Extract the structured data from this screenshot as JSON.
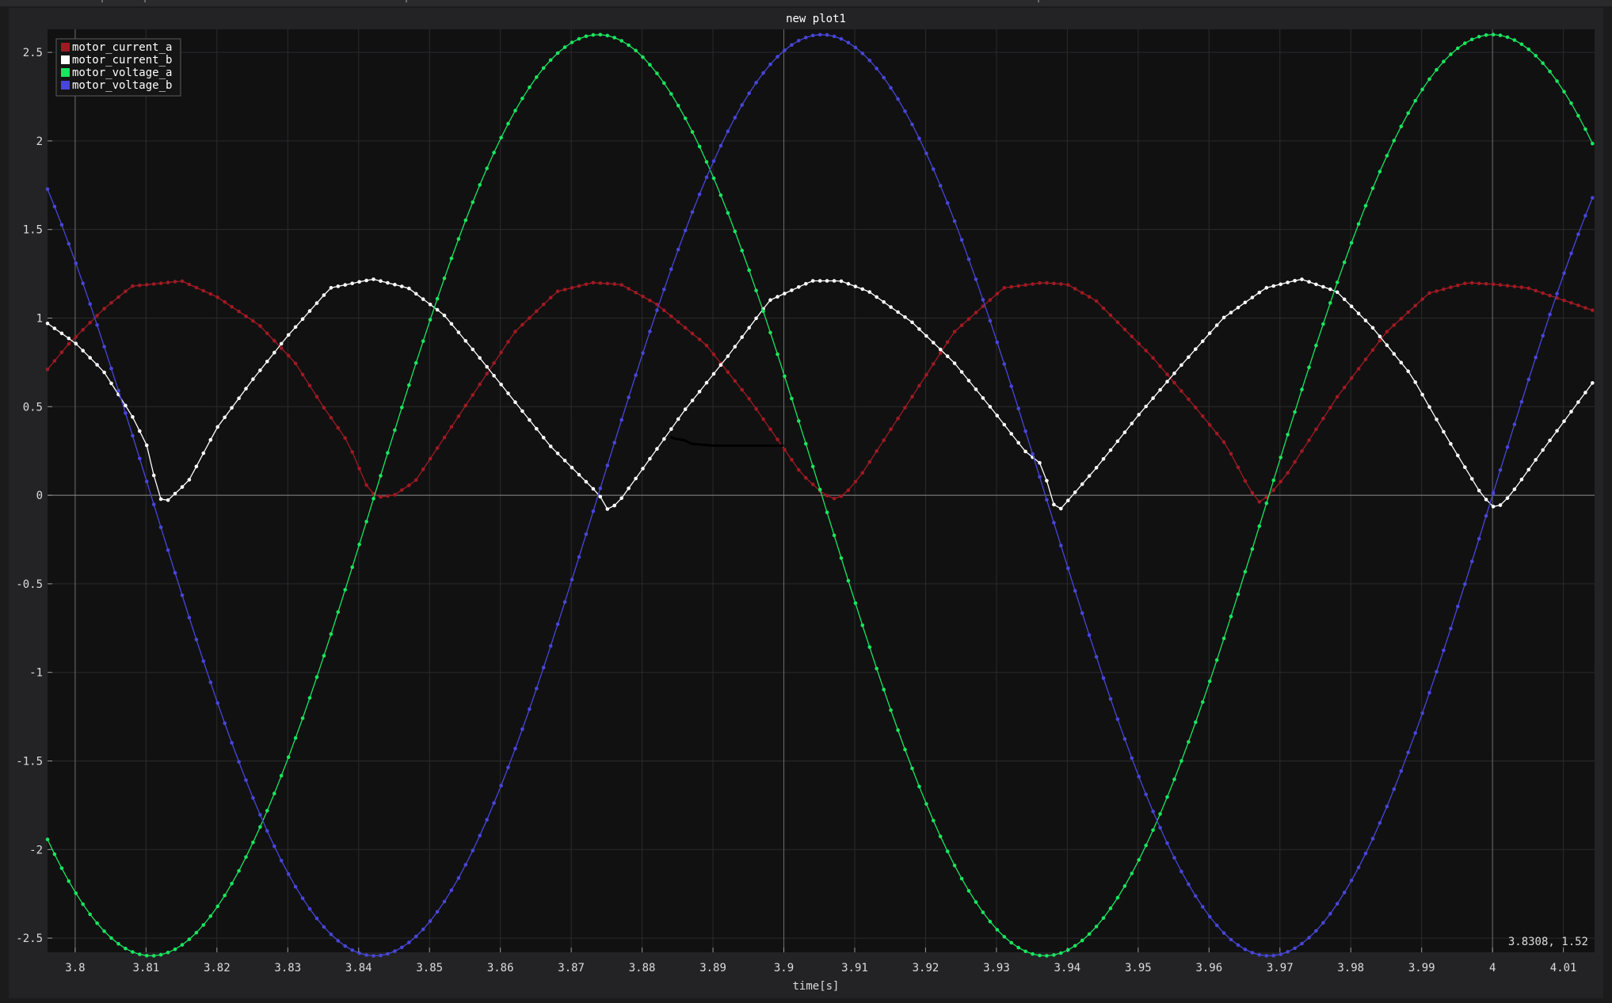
{
  "plot": {
    "title": "new plot1",
    "xlabel": "time[s]",
    "cursor_readout": "3.8308, 1.52"
  },
  "chart_data": {
    "type": "line",
    "title": "new plot1",
    "xlabel": "time[s]",
    "ylabel": "",
    "xlim": [
      3.7961,
      4.0144
    ],
    "ylim": [
      -2.58,
      2.63
    ],
    "x_ticks": [
      "3.8",
      "3.81",
      "3.82",
      "3.83",
      "3.84",
      "3.85",
      "3.86",
      "3.87",
      "3.88",
      "3.89",
      "3.9",
      "3.91",
      "3.92",
      "3.93",
      "3.94",
      "3.95",
      "3.96",
      "3.97",
      "3.98",
      "3.99",
      "4",
      "4.01"
    ],
    "y_ticks": [
      "-2.5",
      "-2",
      "-1.5",
      "-1",
      "-0.5",
      "0",
      "0.5",
      "1",
      "1.5",
      "2",
      "2.5"
    ],
    "grid": true,
    "legend_position": "top-left",
    "sample_interval": 0.001,
    "series": [
      {
        "name": "motor_current_a",
        "color": "#a01a22",
        "x": [
          3.7961,
          3.799,
          3.804,
          3.808,
          3.813,
          3.815,
          3.82,
          3.826,
          3.831,
          3.835,
          3.8385,
          3.8415,
          3.843,
          3.845,
          3.848,
          3.855,
          3.862,
          3.868,
          3.873,
          3.877,
          3.882,
          3.889,
          3.895,
          3.9025,
          3.9055,
          3.907,
          3.9085,
          3.911,
          3.918,
          3.924,
          3.931,
          3.9365,
          3.94,
          3.944,
          3.952,
          3.958,
          3.9625,
          3.9655,
          3.967,
          3.9685,
          3.971,
          3.978,
          3.985,
          3.991,
          3.9965,
          4.0005,
          4.005,
          4.0144
        ],
        "y": [
          0.71,
          0.85,
          1.05,
          1.18,
          1.2,
          1.21,
          1.12,
          0.96,
          0.75,
          0.5,
          0.3,
          0.02,
          -0.01,
          0.0,
          0.08,
          0.5,
          0.92,
          1.15,
          1.2,
          1.19,
          1.08,
          0.85,
          0.55,
          0.12,
          0.01,
          -0.02,
          0.0,
          0.12,
          0.55,
          0.92,
          1.17,
          1.2,
          1.19,
          1.1,
          0.78,
          0.5,
          0.28,
          0.05,
          -0.04,
          0.0,
          0.12,
          0.55,
          0.92,
          1.14,
          1.2,
          1.19,
          1.17,
          1.04
        ]
      },
      {
        "name": "motor_current_b",
        "color": "#ffffff",
        "x": [
          3.7961,
          3.8,
          3.804,
          3.808,
          3.8095,
          3.8105,
          3.8115,
          3.8125,
          3.816,
          3.82,
          3.825,
          3.83,
          3.836,
          3.842,
          3.847,
          3.852,
          3.857,
          3.862,
          3.867,
          3.8715,
          3.874,
          3.875,
          3.8765,
          3.881,
          3.886,
          3.892,
          3.898,
          3.904,
          3.908,
          3.912,
          3.918,
          3.924,
          3.9295,
          3.934,
          3.9365,
          3.938,
          3.939,
          3.944,
          3.95,
          3.956,
          3.962,
          3.968,
          3.973,
          3.978,
          3.983,
          3.9885,
          3.9935,
          3.9985,
          4.0005,
          4.0025,
          4.007,
          4.0144
        ],
        "y": [
          0.97,
          0.86,
          0.7,
          0.45,
          0.33,
          0.25,
          0.02,
          -0.05,
          0.08,
          0.38,
          0.65,
          0.9,
          1.17,
          1.22,
          1.17,
          1.02,
          0.78,
          0.53,
          0.28,
          0.1,
          0.0,
          -0.08,
          -0.05,
          0.2,
          0.48,
          0.78,
          1.1,
          1.21,
          1.21,
          1.15,
          0.98,
          0.75,
          0.48,
          0.25,
          0.17,
          -0.05,
          -0.08,
          0.15,
          0.45,
          0.73,
          1.0,
          1.17,
          1.22,
          1.15,
          0.95,
          0.68,
          0.33,
          0.0,
          -0.08,
          0.0,
          0.25,
          0.65
        ]
      },
      {
        "name": "motor_voltage_a",
        "color": "#1ae65f",
        "formula": "y = 2.6*sin(2*pi*(t-3.8107)/0.1262 - pi/2)",
        "amplitude": 2.6,
        "period": 0.1262,
        "phase_zero_x": 3.8107,
        "x": [
          3.7961,
          3.8107,
          3.8423,
          3.8738,
          3.9054,
          3.9369,
          3.9685,
          4.0,
          4.0144
        ],
        "y": [
          -1.88,
          -2.6,
          0.0,
          2.6,
          0.0,
          -2.6,
          0.0,
          2.6,
          1.93
        ]
      },
      {
        "name": "motor_voltage_b",
        "color": "#4846d8",
        "formula": "y = 2.6*sin(2*pi*(t-3.8107)/0.1262 - pi)",
        "amplitude": 2.6,
        "period": 0.1262,
        "phase_zero_x": 3.8107,
        "x": [
          3.7961,
          3.8107,
          3.8423,
          3.8738,
          3.9054,
          3.9369,
          3.9685,
          4.0,
          4.0144
        ],
        "y": [
          1.78,
          0.0,
          -2.6,
          0.0,
          2.6,
          0.0,
          -2.6,
          0.0,
          1.78
        ]
      },
      {
        "name": "",
        "color": "#000000",
        "x": [
          3.884,
          3.8845,
          3.886,
          3.887,
          3.89,
          3.895,
          3.9
        ],
        "y": [
          0.33,
          0.32,
          0.31,
          0.29,
          0.28,
          0.28,
          0.28
        ]
      }
    ],
    "reference_lines": {
      "vertical_x": [
        3.8,
        3.9,
        4.0
      ],
      "horizontal_y": [
        0
      ]
    }
  }
}
